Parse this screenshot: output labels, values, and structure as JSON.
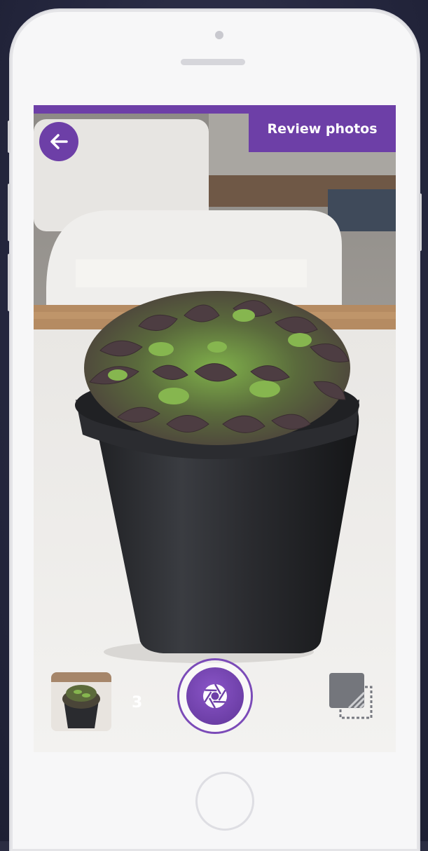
{
  "header": {
    "review_label": "Review photos"
  },
  "capture": {
    "photo_count": "3"
  },
  "icons": {
    "back": "arrow-left-icon",
    "shutter": "camera-shutter-icon",
    "mode": "multi-capture-mode-icon"
  },
  "colors": {
    "accent": "#6d3fa7",
    "frame": "#f7f7f8",
    "background": "#2b2d42"
  }
}
